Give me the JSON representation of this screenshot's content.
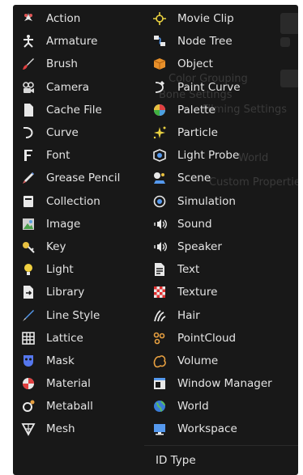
{
  "background_labels": [
    "Color Grouping",
    "Bone Settings",
    "Filming Settings",
    "World",
    "Custom Properties"
  ],
  "left_items": [
    {
      "label": "Action",
      "icon": "action-icon"
    },
    {
      "label": "Armature",
      "icon": "armature-icon"
    },
    {
      "label": "Brush",
      "icon": "brush-icon"
    },
    {
      "label": "Camera",
      "icon": "camera-icon"
    },
    {
      "label": "Cache File",
      "icon": "cache-file-icon"
    },
    {
      "label": "Curve",
      "icon": "curve-icon"
    },
    {
      "label": "Font",
      "icon": "font-icon"
    },
    {
      "label": "Grease Pencil",
      "icon": "grease-pencil-icon"
    },
    {
      "label": "Collection",
      "icon": "collection-icon"
    },
    {
      "label": "Image",
      "icon": "image-icon"
    },
    {
      "label": "Key",
      "icon": "key-icon"
    },
    {
      "label": "Light",
      "icon": "light-icon"
    },
    {
      "label": "Library",
      "icon": "library-icon"
    },
    {
      "label": "Line Style",
      "icon": "line-style-icon"
    },
    {
      "label": "Lattice",
      "icon": "lattice-icon"
    },
    {
      "label": "Mask",
      "icon": "mask-icon"
    },
    {
      "label": "Material",
      "icon": "material-icon"
    },
    {
      "label": "Metaball",
      "icon": "metaball-icon"
    },
    {
      "label": "Mesh",
      "icon": "mesh-icon"
    }
  ],
  "right_items": [
    {
      "label": "Movie Clip",
      "icon": "movie-clip-icon"
    },
    {
      "label": "Node Tree",
      "icon": "node-tree-icon"
    },
    {
      "label": "Object",
      "icon": "object-icon"
    },
    {
      "label": "Paint Curve",
      "icon": "paint-curve-icon"
    },
    {
      "label": "Palette",
      "icon": "palette-icon"
    },
    {
      "label": "Particle",
      "icon": "particle-icon"
    },
    {
      "label": "Light Probe",
      "icon": "light-probe-icon"
    },
    {
      "label": "Scene",
      "icon": "scene-icon"
    },
    {
      "label": "Simulation",
      "icon": "simulation-icon"
    },
    {
      "label": "Sound",
      "icon": "sound-icon"
    },
    {
      "label": "Speaker",
      "icon": "speaker-icon"
    },
    {
      "label": "Text",
      "icon": "text-icon"
    },
    {
      "label": "Texture",
      "icon": "texture-icon"
    },
    {
      "label": "Hair",
      "icon": "hair-icon"
    },
    {
      "label": "PointCloud",
      "icon": "pointcloud-icon"
    },
    {
      "label": "Volume",
      "icon": "volume-icon"
    },
    {
      "label": "Window Manager",
      "icon": "window-manager-icon"
    },
    {
      "label": "World",
      "icon": "world-icon"
    },
    {
      "label": "Workspace",
      "icon": "workspace-icon"
    }
  ],
  "footer_label": "ID Type"
}
